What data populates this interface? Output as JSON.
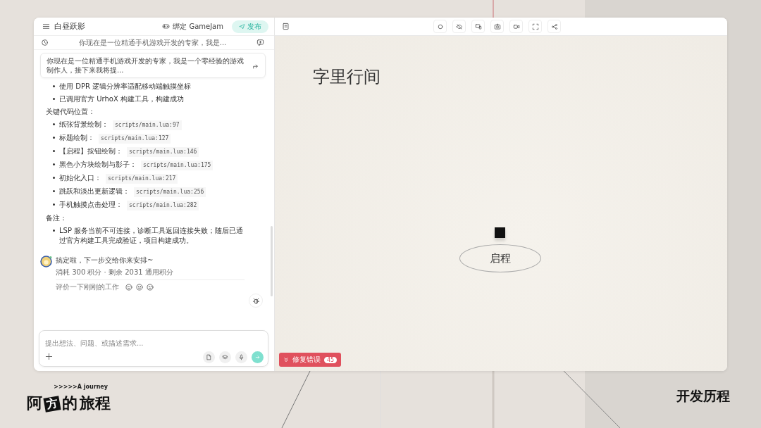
{
  "header": {
    "title": "白昼跃影",
    "bind_label": "绑定 GameJam",
    "publish_label": "发布"
  },
  "prompt_bar": {
    "text": "你现在是一位精通手机游戏开发的专家，我是..."
  },
  "user_message": "你现在是一位精通手机游戏开发的专家，我是一个零经验的游戏制作人，接下来我将提...",
  "response": [
    {
      "kind": "bullet",
      "text": "使用 DPR 逻辑分辨率适配移动端触摸坐标"
    },
    {
      "kind": "bullet",
      "text": "已调用官方 UrhoX 构建工具，构建成功"
    },
    {
      "kind": "heading",
      "text": "关键代码位置："
    },
    {
      "kind": "code",
      "text": "纸张背景绘制：",
      "code": "scripts/main.lua:97"
    },
    {
      "kind": "code",
      "text": "标题绘制：",
      "code": "scripts/main.lua:127"
    },
    {
      "kind": "code",
      "text": "【启程】按钮绘制：",
      "code": "scripts/main.lua:146"
    },
    {
      "kind": "code",
      "text": "黑色小方块绘制与影子：",
      "code": "scripts/main.lua:175"
    },
    {
      "kind": "code",
      "text": "初始化入口：",
      "code": "scripts/main.lua:217"
    },
    {
      "kind": "code",
      "text": "跳跃和淡出更新逻辑：",
      "code": "scripts/main.lua:256"
    },
    {
      "kind": "code",
      "text": "手机触摸点击处理：",
      "code": "scripts/main.lua:282"
    },
    {
      "kind": "heading",
      "text": "备注："
    },
    {
      "kind": "bullet",
      "text": "LSP 服务当前不可连接，诊断工具返回连接失败；随后已通过官方构建工具完成验证，项目构建成功。"
    }
  ],
  "assistant": {
    "message": "搞定啦，下一步交给你来安排~",
    "usage": "消耗 300 积分 · 剩余 2031 通用积分",
    "rating_prompt": "评价一下刚刚的工作"
  },
  "composer": {
    "placeholder": "提出想法、问题、或描述需求..."
  },
  "preview": {
    "title": "字里行间",
    "start_button": "启程",
    "fix_button": "修复错误",
    "error_count": "45"
  },
  "overlay": {
    "logo_parts": [
      {
        "kind": "plain",
        "text": "阿"
      },
      {
        "kind": "boxed",
        "text": "方"
      },
      {
        "kind": "plain",
        "text": "的"
      },
      {
        "kind": "plain",
        "text": "旅程"
      }
    ],
    "logo_tagline": ">>>>>A journey",
    "caption": "开发历程"
  }
}
